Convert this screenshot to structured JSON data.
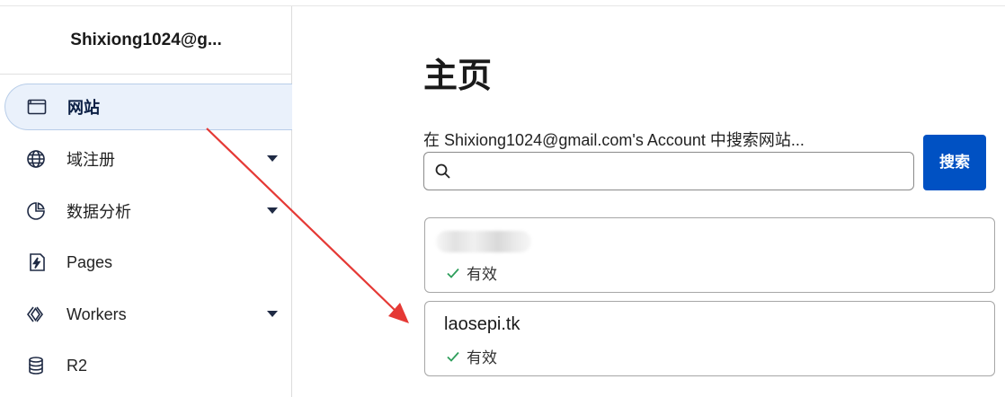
{
  "sidebar": {
    "account_name": "Shixiong1024@g...",
    "items": [
      {
        "label": "网站",
        "icon": "browser-window-icon",
        "active": true,
        "has_dropdown": false
      },
      {
        "label": "域注册",
        "icon": "globe-icon",
        "active": false,
        "has_dropdown": true
      },
      {
        "label": "数据分析",
        "icon": "pie-chart-icon",
        "active": false,
        "has_dropdown": true
      },
      {
        "label": "Pages",
        "icon": "lightning-icon",
        "active": false,
        "has_dropdown": false
      },
      {
        "label": "Workers",
        "icon": "workers-icon",
        "active": false,
        "has_dropdown": true
      },
      {
        "label": "R2",
        "icon": "database-icon",
        "active": false,
        "has_dropdown": false
      }
    ]
  },
  "main": {
    "title": "主页",
    "search": {
      "label": "在 Shixiong1024@gmail.com's Account 中搜索网站...",
      "value": "",
      "button_label": "搜索"
    },
    "sites": [
      {
        "name": "",
        "blurred": true,
        "status": "有效"
      },
      {
        "name": "laosepi.tk",
        "blurred": false,
        "status": "有效"
      }
    ]
  },
  "colors": {
    "accent": "#0051c3",
    "active_nav_bg": "#eaf1fb",
    "status_check": "#2e9e5b",
    "annotation_arrow": "#e53935"
  }
}
